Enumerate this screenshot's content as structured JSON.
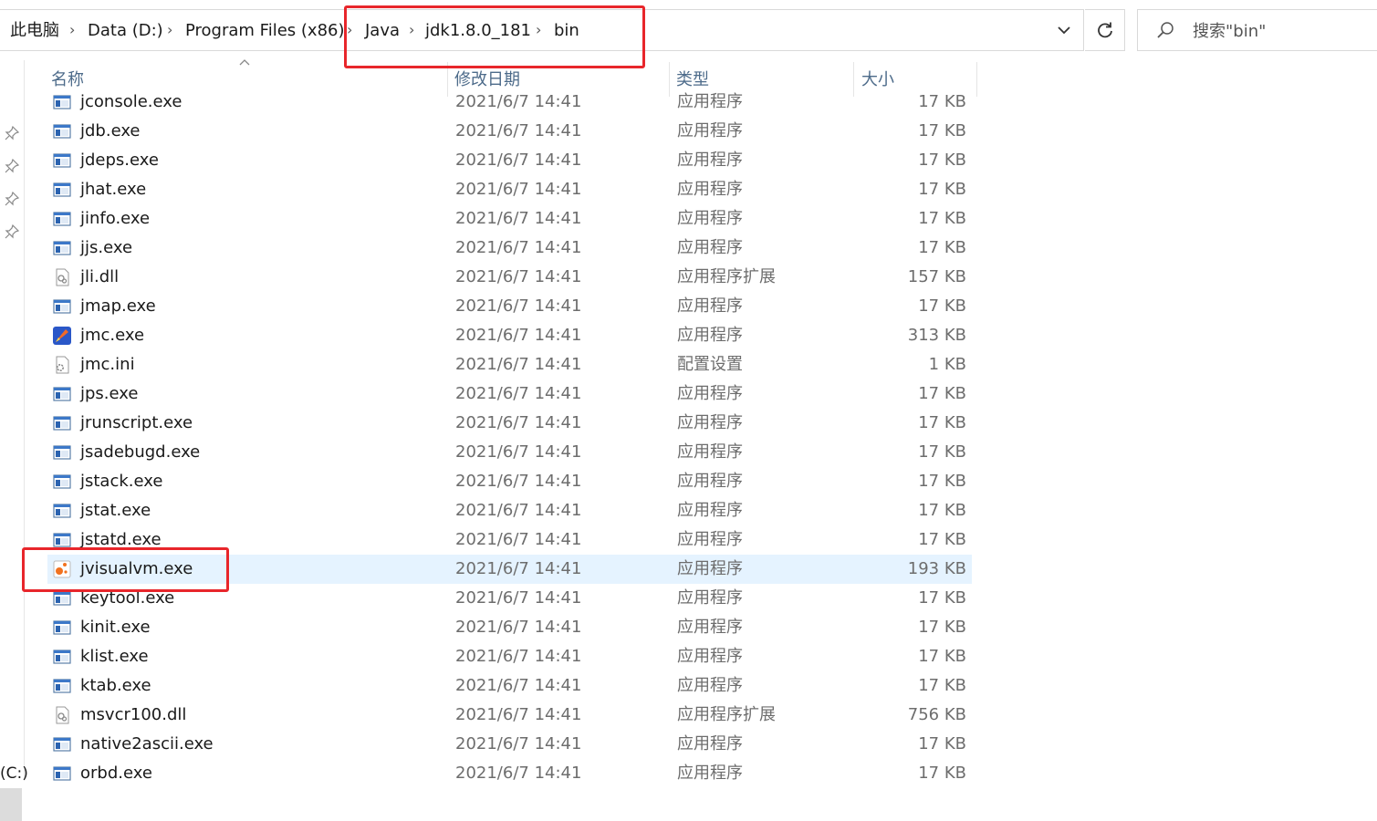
{
  "breadcrumb": [
    "此电脑",
    "Data (D:)",
    "Program Files (x86)",
    "Java",
    "jdk1.8.0_181",
    "bin"
  ],
  "search": {
    "placeholder": "搜索\"bin\""
  },
  "columns": {
    "name": "名称",
    "date": "修改日期",
    "type": "类型",
    "size": "大小"
  },
  "nav": {
    "drive_label": "(C:)"
  },
  "selected_file": "jvisualvm.exe",
  "files": [
    {
      "name": "jconsole.exe",
      "date": "2021/6/7 14:41",
      "type": "应用程序",
      "size": "17 KB",
      "icon": "app-icon"
    },
    {
      "name": "jdb.exe",
      "date": "2021/6/7 14:41",
      "type": "应用程序",
      "size": "17 KB",
      "icon": "app-icon"
    },
    {
      "name": "jdeps.exe",
      "date": "2021/6/7 14:41",
      "type": "应用程序",
      "size": "17 KB",
      "icon": "app-icon"
    },
    {
      "name": "jhat.exe",
      "date": "2021/6/7 14:41",
      "type": "应用程序",
      "size": "17 KB",
      "icon": "app-icon"
    },
    {
      "name": "jinfo.exe",
      "date": "2021/6/7 14:41",
      "type": "应用程序",
      "size": "17 KB",
      "icon": "app-icon"
    },
    {
      "name": "jjs.exe",
      "date": "2021/6/7 14:41",
      "type": "应用程序",
      "size": "17 KB",
      "icon": "app-icon"
    },
    {
      "name": "jli.dll",
      "date": "2021/6/7 14:41",
      "type": "应用程序扩展",
      "size": "157 KB",
      "icon": "dll-icon"
    },
    {
      "name": "jmap.exe",
      "date": "2021/6/7 14:41",
      "type": "应用程序",
      "size": "17 KB",
      "icon": "app-icon"
    },
    {
      "name": "jmc.exe",
      "date": "2021/6/7 14:41",
      "type": "应用程序",
      "size": "313 KB",
      "icon": "jmc-icon"
    },
    {
      "name": "jmc.ini",
      "date": "2021/6/7 14:41",
      "type": "配置设置",
      "size": "1 KB",
      "icon": "ini-icon"
    },
    {
      "name": "jps.exe",
      "date": "2021/6/7 14:41",
      "type": "应用程序",
      "size": "17 KB",
      "icon": "app-icon"
    },
    {
      "name": "jrunscript.exe",
      "date": "2021/6/7 14:41",
      "type": "应用程序",
      "size": "17 KB",
      "icon": "app-icon"
    },
    {
      "name": "jsadebugd.exe",
      "date": "2021/6/7 14:41",
      "type": "应用程序",
      "size": "17 KB",
      "icon": "app-icon"
    },
    {
      "name": "jstack.exe",
      "date": "2021/6/7 14:41",
      "type": "应用程序",
      "size": "17 KB",
      "icon": "app-icon"
    },
    {
      "name": "jstat.exe",
      "date": "2021/6/7 14:41",
      "type": "应用程序",
      "size": "17 KB",
      "icon": "app-icon"
    },
    {
      "name": "jstatd.exe",
      "date": "2021/6/7 14:41",
      "type": "应用程序",
      "size": "17 KB",
      "icon": "app-icon"
    },
    {
      "name": "jvisualvm.exe",
      "date": "2021/6/7 14:41",
      "type": "应用程序",
      "size": "193 KB",
      "icon": "jvisualvm-icon"
    },
    {
      "name": "keytool.exe",
      "date": "2021/6/7 14:41",
      "type": "应用程序",
      "size": "17 KB",
      "icon": "app-icon"
    },
    {
      "name": "kinit.exe",
      "date": "2021/6/7 14:41",
      "type": "应用程序",
      "size": "17 KB",
      "icon": "app-icon"
    },
    {
      "name": "klist.exe",
      "date": "2021/6/7 14:41",
      "type": "应用程序",
      "size": "17 KB",
      "icon": "app-icon"
    },
    {
      "name": "ktab.exe",
      "date": "2021/6/7 14:41",
      "type": "应用程序",
      "size": "17 KB",
      "icon": "app-icon"
    },
    {
      "name": "msvcr100.dll",
      "date": "2021/6/7 14:41",
      "type": "应用程序扩展",
      "size": "756 KB",
      "icon": "dll-icon"
    },
    {
      "name": "native2ascii.exe",
      "date": "2021/6/7 14:41",
      "type": "应用程序",
      "size": "17 KB",
      "icon": "app-icon"
    },
    {
      "name": "orbd.exe",
      "date": "2021/6/7 14:41",
      "type": "应用程序",
      "size": "17 KB",
      "icon": "app-icon"
    }
  ]
}
